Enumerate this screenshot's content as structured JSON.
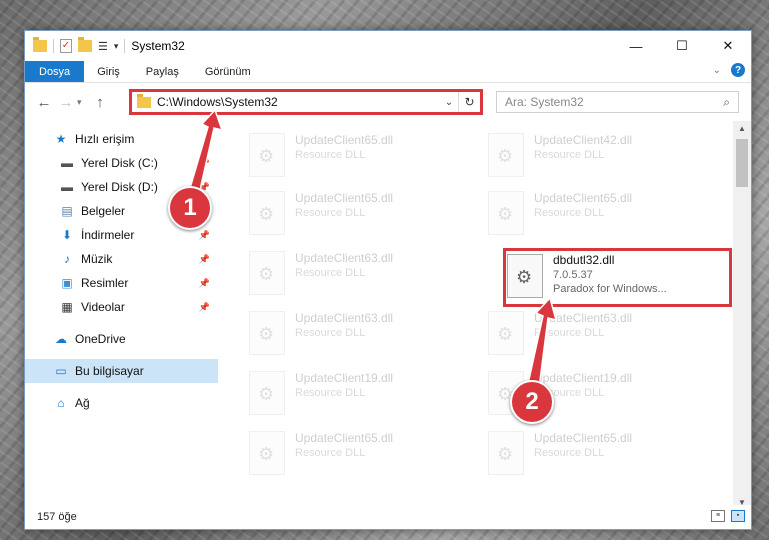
{
  "window": {
    "title": "System32",
    "controls": {
      "minimize": "—",
      "maximize": "☐",
      "close": "✕"
    }
  },
  "ribbon": {
    "tabs": [
      {
        "label": "Dosya",
        "active": true
      },
      {
        "label": "Giriş",
        "active": false
      },
      {
        "label": "Paylaş",
        "active": false
      },
      {
        "label": "Görünüm",
        "active": false
      }
    ],
    "help": "?"
  },
  "address": {
    "path": "C:\\Windows\\System32",
    "refresh": "↻"
  },
  "search": {
    "placeholder": "Ara: System32"
  },
  "nav": {
    "items": [
      {
        "label": "Hızlı erişim",
        "icon": "star-icon"
      },
      {
        "label": "Yerel Disk (C:)",
        "icon": "drive-icon",
        "pinned": true
      },
      {
        "label": "Yerel Disk (D:)",
        "icon": "drive-icon",
        "pinned": true
      },
      {
        "label": "Belgeler",
        "icon": "documents-icon",
        "pinned": true
      },
      {
        "label": "İndirmeler",
        "icon": "download-icon",
        "pinned": true
      },
      {
        "label": "Müzik",
        "icon": "music-icon",
        "pinned": true
      },
      {
        "label": "Resimler",
        "icon": "pictures-icon",
        "pinned": true
      },
      {
        "label": "Videolar",
        "icon": "videos-icon",
        "pinned": true
      },
      {
        "label": "OneDrive",
        "icon": "cloud-icon"
      },
      {
        "label": "Bu bilgisayar",
        "icon": "computer-icon",
        "selected": true
      },
      {
        "label": "Ağ",
        "icon": "network-icon"
      }
    ]
  },
  "files": {
    "col1": [
      {
        "name": "UpdateClient65.dll",
        "type": "Resource DLL"
      },
      {
        "name": "UpdateClient65.dll",
        "type": "Resource DLL"
      },
      {
        "name": "UpdateClient63.dll",
        "type": "Resource DLL"
      },
      {
        "name": "UpdateClient63.dll",
        "type": "Resource DLL"
      },
      {
        "name": "UpdateClient19.dll",
        "type": "Resource DLL"
      },
      {
        "name": "UpdateClient65.dll",
        "type": "Resource DLL"
      }
    ],
    "col2": [
      {
        "name": "UpdateClient42.dll",
        "type": "Resource DLL"
      },
      {
        "name": "UpdateClient65.dll",
        "type": "Resource DLL"
      },
      {
        "name": "UpdateClient63.dll",
        "type": "Resource DLL"
      },
      {
        "name": "UpdateClient19.dll",
        "type": "Resource DLL"
      },
      {
        "name": "UpdateClient65.dll",
        "type": "Resource DLL"
      }
    ],
    "highlighted": {
      "name": "dbdutl32.dll",
      "version": "7.0.5.37",
      "description": "Paradox for Windows..."
    }
  },
  "status": {
    "count": "157 öğe"
  },
  "callouts": {
    "one": "1",
    "two": "2"
  },
  "colors": {
    "accent": "#1979ca",
    "highlight": "#d9363e",
    "selected": "#cce4f7"
  }
}
